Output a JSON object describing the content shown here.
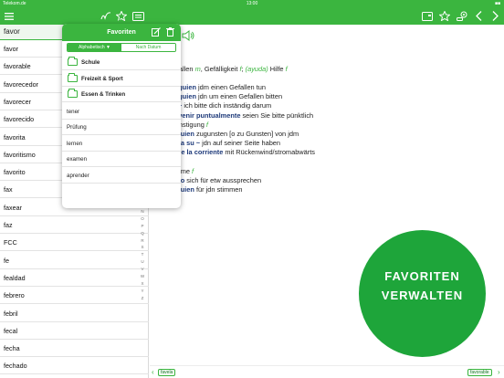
{
  "status_bar": {
    "carrier": "Telekom.de",
    "time": "13:00",
    "battery": "■■"
  },
  "colors": {
    "accent": "#3bb53f",
    "cta": "#1ea53a",
    "phrase": "#1e3a7a"
  },
  "header": {
    "left_icons": [
      "menu-icon",
      "handwriting-icon",
      "star-icon",
      "keyboard-icon"
    ],
    "right_icons": [
      "window-icon",
      "star-outline-icon",
      "settings-icon",
      "back-icon",
      "forward-icon"
    ]
  },
  "sidebar": {
    "search_value": "favor",
    "words": [
      "favor",
      "favorable",
      "favorecedor",
      "favorecer",
      "favorecido",
      "favorita",
      "favoritismo",
      "favorito",
      "fax",
      "faxear",
      "faz",
      "FCC",
      "fe",
      "fealdad",
      "febrero",
      "febril",
      "fecal",
      "fecha",
      "fechado",
      "fechar"
    ],
    "alpha_index": [
      "M",
      "N",
      "O",
      "P",
      "Q",
      "R",
      "S",
      "T",
      "U",
      "V",
      "W",
      "X",
      "Y",
      "Z"
    ],
    "info": "i"
  },
  "popover": {
    "title": "Favoriten",
    "sort_options": [
      "Alphabetisch ▼",
      "Nach Datum"
    ],
    "folders": [
      "Schule",
      "Freizeit & Sport",
      "Essen & Trinken"
    ],
    "words": [
      "tener",
      "Prüfung",
      "lernen",
      "examen",
      "aprender"
    ]
  },
  "entry": {
    "lines": [
      {
        "segments": [
          {
            "t": "cio)",
            "s": "lbl"
          },
          {
            "t": " Gefallen ",
            "s": ""
          },
          {
            "t": "m",
            "s": "gram"
          },
          {
            "t": ", Gefälligkeit ",
            "s": ""
          },
          {
            "t": "f",
            "s": "gram"
          },
          {
            "t": "; ",
            "s": ""
          },
          {
            "t": "(ayuda)",
            "s": "lbl"
          },
          {
            "t": " Hilfe ",
            "s": ""
          },
          {
            "t": "f",
            "s": "gram"
          }
        ]
      },
      {
        "segments": [
          {
            "t": "itte",
            "s": ""
          }
        ]
      },
      {
        "segments": [
          {
            "t": "n ~ a alguien",
            "s": "ph"
          },
          {
            "t": " jdm einen Gefallen tun",
            "s": ""
          }
        ]
      },
      {
        "segments": [
          {
            "t": "n ~ a alguien",
            "s": "ph"
          },
          {
            "t": " jdn um einen Gefallen bitten",
            "s": ""
          }
        ]
      },
      {
        "segments": [
          {
            "t": "do por ~",
            "s": "ph"
          },
          {
            "t": " ich bitte dich inständig darum",
            "s": ""
          }
        ]
      },
      {
        "segments": [
          {
            "t": "el ~ de venir puntualmente",
            "s": "ph"
          },
          {
            "t": " seien Sie bitte pünktlich",
            "s": ""
          }
        ]
      },
      {
        "segments": [
          {
            "t": "a)",
            "s": "lbl"
          },
          {
            "t": " Begünstigung ",
            "s": ""
          },
          {
            "t": "f",
            "s": "gram"
          }
        ]
      },
      {
        "segments": [
          {
            "t": "~ de alguien",
            "s": "ph"
          },
          {
            "t": " zugunsten [o zu Gunsten] von jdm",
            "s": ""
          }
        ]
      },
      {
        "segments": [
          {
            "t": "alguien a su ~",
            "s": "ph"
          },
          {
            "t": " jdn auf seiner Seite haben",
            "s": ""
          }
        ]
      },
      {
        "segments": [
          {
            "t": "viento/de la corriente",
            "s": "ph"
          },
          {
            "t": " mit Rückenwind/stromabwärts",
            "s": ""
          }
        ]
      },
      {
        "segments": [
          {
            "t": "ficio)",
            "s": "lbl"
          }
        ]
      },
      {
        "segments": [
          {
            "t": "~ Jastimme ",
            "s": ""
          },
          {
            "t": "f",
            "s": "gram"
          }
        ]
      },
      {
        "segments": [
          {
            "t": "~ de algo",
            "s": "ph"
          },
          {
            "t": " sich für etw aussprechen",
            "s": ""
          }
        ]
      },
      {
        "segments": [
          {
            "t": "~ de alguien",
            "s": "ph"
          },
          {
            "t": " für jdn stimmen",
            "s": ""
          }
        ]
      }
    ]
  },
  "cta": {
    "line1": "FAVORITEN",
    "line2": "VERWALTEN"
  },
  "bottom_nav": {
    "prev": "favela",
    "next": "favorable",
    "prev_chevron": "‹",
    "next_chevron": "›"
  }
}
